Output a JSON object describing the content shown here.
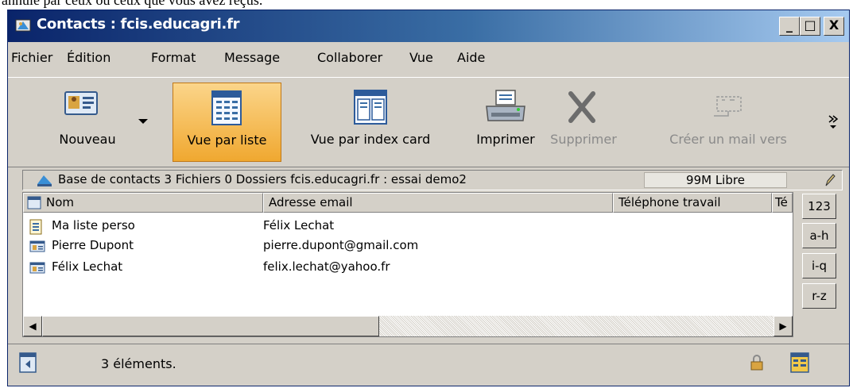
{
  "caption": "annulé par ceux ou ceux que vous avez reçus.",
  "window": {
    "title": "Contacts : fcis.educagri.fr",
    "controls": [
      "_",
      "□",
      "X"
    ]
  },
  "menu": [
    "Fichier",
    "Édition",
    "Format",
    "Message",
    "Collaborer",
    "Vue",
    "Aide"
  ],
  "toolbar": {
    "new": "Nouveau",
    "list_view": "Vue par liste",
    "card_view": "Vue par index card",
    "print": "Imprimer",
    "delete": "Supprimer",
    "mail": "Créer un mail vers",
    "more": "»"
  },
  "info": {
    "text": "Base de contacts   3 Fichiers  0 Dossiers   fcis.educagri.fr : essai demo2",
    "free": "99M Libre"
  },
  "columns": [
    "Nom",
    "Adresse email",
    "Téléphone travail",
    "Té"
  ],
  "rows": [
    {
      "name": "Ma liste perso",
      "email": "Félix Lechat"
    },
    {
      "name": "Pierre Dupont",
      "email": "pierre.dupont@gmail.com"
    },
    {
      "name": "Félix Lechat",
      "email": "felix.lechat@yahoo.fr"
    }
  ],
  "alpha": [
    "123",
    "a-h",
    "i-q",
    "r-z"
  ],
  "status": "3 éléments."
}
